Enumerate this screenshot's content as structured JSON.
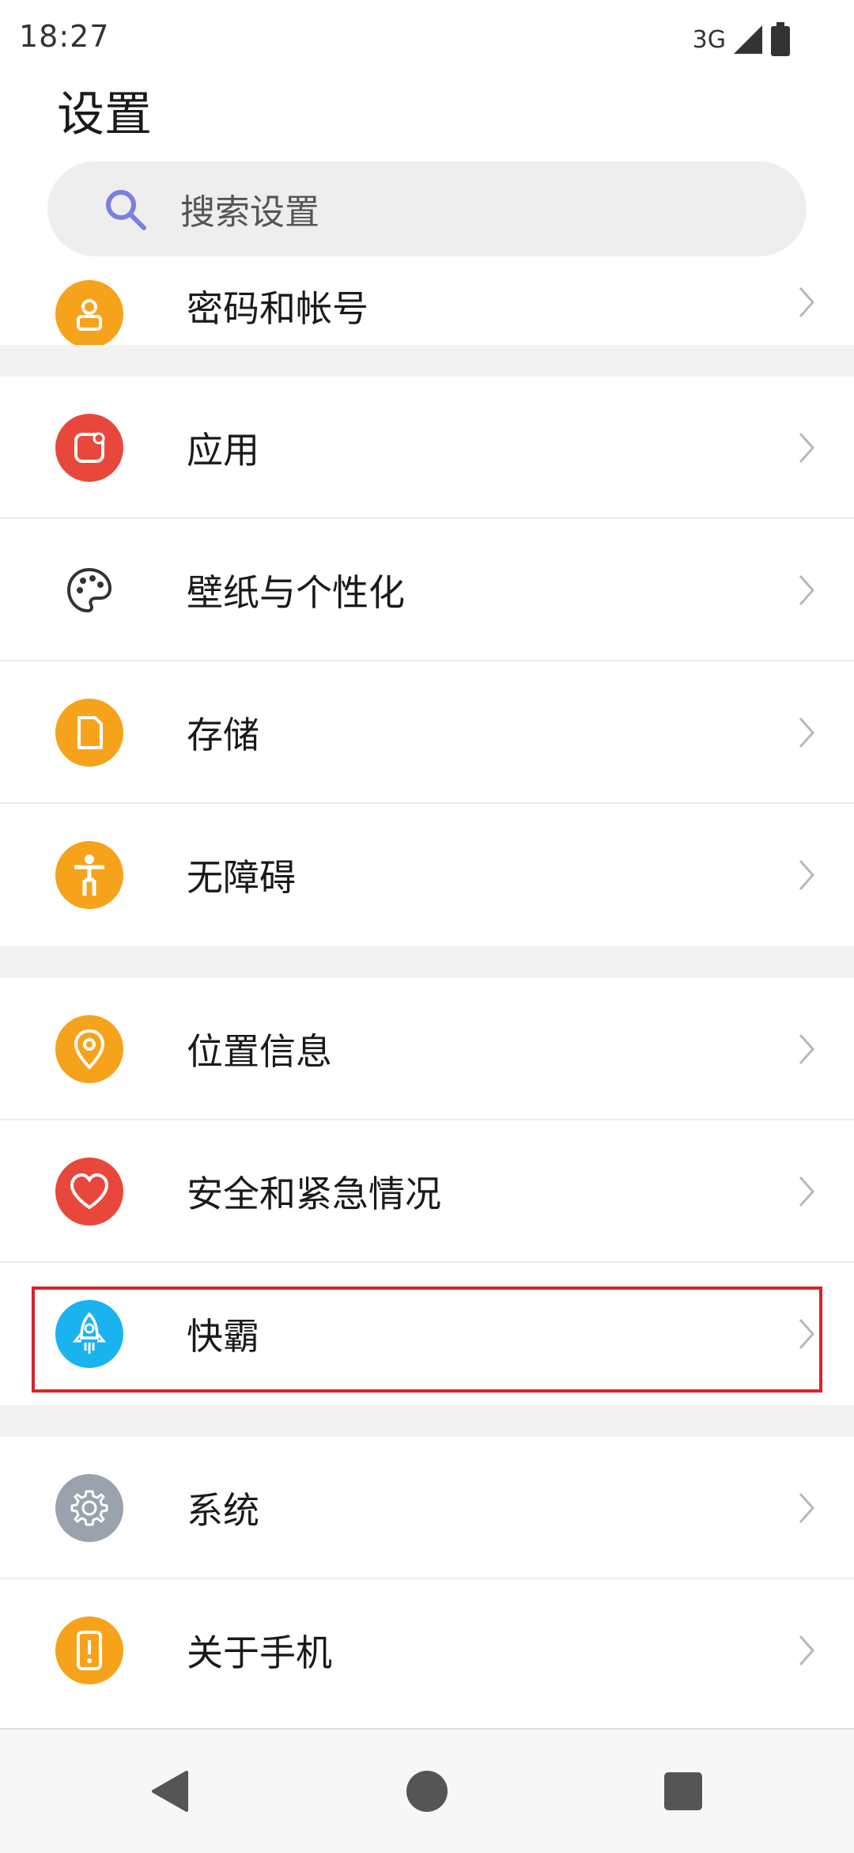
{
  "status_bar": {
    "time": "18:27",
    "network": "3G",
    "icons": [
      "signal-icon",
      "battery-icon"
    ]
  },
  "page": {
    "title": "设置"
  },
  "search": {
    "placeholder": "搜索设置",
    "icon": "search-icon",
    "accent": "#7b7fe0"
  },
  "partial_item": {
    "label": "密码和帐号",
    "icon": "account-icon",
    "color": "#f7a21b"
  },
  "groups": [
    {
      "items": [
        {
          "label": "应用",
          "icon": "apps-icon",
          "color": "#e8473b"
        },
        {
          "label": "壁纸与个性化",
          "icon": "palette-icon",
          "color": "#ffffff"
        },
        {
          "label": "存储",
          "icon": "storage-icon",
          "color": "#f7a21b"
        },
        {
          "label": "无障碍",
          "icon": "accessibility-icon",
          "color": "#f7a21b"
        }
      ]
    },
    {
      "items": [
        {
          "label": "位置信息",
          "icon": "location-icon",
          "color": "#f7a21b"
        },
        {
          "label": "安全和紧急情况",
          "icon": "heart-icon",
          "color": "#e8473b"
        },
        {
          "label": "快霸",
          "icon": "rocket-icon",
          "color": "#1ab3f0",
          "highlighted": true
        }
      ]
    },
    {
      "items": [
        {
          "label": "系统",
          "icon": "gear-icon",
          "color": "#9aa3ad"
        },
        {
          "label": "关于手机",
          "icon": "phone-info-icon",
          "color": "#f7a21b"
        }
      ]
    }
  ],
  "nav_bar": {
    "buttons": [
      "back-icon",
      "home-icon",
      "recents-icon"
    ]
  }
}
